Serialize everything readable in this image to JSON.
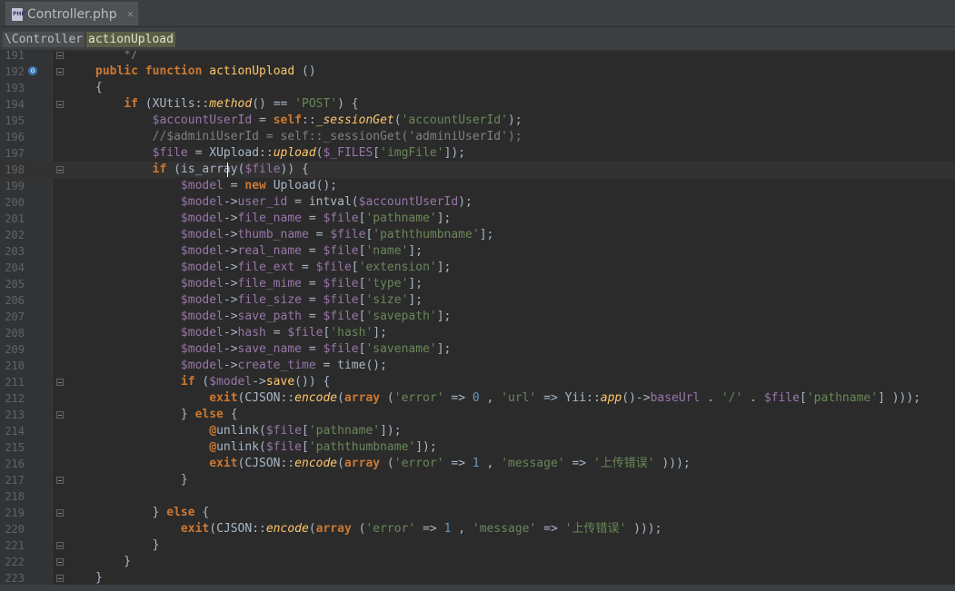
{
  "tab": {
    "file_name": "Controller.php",
    "icon": "php-file-icon",
    "close": "×"
  },
  "breadcrumb": {
    "class": "\\Controller",
    "method": "actionUpload"
  },
  "colors": {
    "background": "#2b2b2b",
    "keyword": "#cc7832",
    "function": "#ffc66d",
    "variable": "#9876aa",
    "string": "#6a8759",
    "number": "#6897bb",
    "comment": "#808080"
  },
  "lines": [
    {
      "n": "191",
      "t": "    */"
    },
    {
      "n": "192",
      "t": "public function actionUpload ()"
    },
    {
      "n": "193",
      "t": "{"
    },
    {
      "n": "194",
      "t": "    if (XUtils::method() == 'POST') {"
    },
    {
      "n": "195",
      "t": "        $accountUserId = self::_sessionGet('accountUserId');"
    },
    {
      "n": "196",
      "t": "        //$adminiUserId = self::_sessionGet('adminiUserId');"
    },
    {
      "n": "197",
      "t": "        $file = XUpload::upload($_FILES['imgFile']);"
    },
    {
      "n": "198",
      "t": "        if (is_array($file)) {"
    },
    {
      "n": "199",
      "t": "            $model = new Upload();"
    },
    {
      "n": "200",
      "t": "            $model->user_id = intval($accountUserId);"
    },
    {
      "n": "201",
      "t": "            $model->file_name = $file['pathname'];"
    },
    {
      "n": "202",
      "t": "            $model->thumb_name = $file['paththumbname'];"
    },
    {
      "n": "203",
      "t": "            $model->real_name = $file['name'];"
    },
    {
      "n": "204",
      "t": "            $model->file_ext = $file['extension'];"
    },
    {
      "n": "205",
      "t": "            $model->file_mime = $file['type'];"
    },
    {
      "n": "206",
      "t": "            $model->file_size = $file['size'];"
    },
    {
      "n": "207",
      "t": "            $model->save_path = $file['savepath'];"
    },
    {
      "n": "208",
      "t": "            $model->hash = $file['hash'];"
    },
    {
      "n": "209",
      "t": "            $model->save_name = $file['savename'];"
    },
    {
      "n": "210",
      "t": "            $model->create_time = time();"
    },
    {
      "n": "211",
      "t": "            if ($model->save()) {"
    },
    {
      "n": "212",
      "t": "                exit(CJSON::encode(array ('error' => 0 , 'url' => Yii::app()->baseUrl . '/' . $file['pathname'] )));"
    },
    {
      "n": "213",
      "t": "            } else {"
    },
    {
      "n": "214",
      "t": "                @unlink($file['pathname']);"
    },
    {
      "n": "215",
      "t": "                @unlink($file['paththumbname']);"
    },
    {
      "n": "216",
      "t": "                exit(CJSON::encode(array ('error' => 1 , 'message' => '上传错误' )));"
    },
    {
      "n": "217",
      "t": "            }"
    },
    {
      "n": "218",
      "t": ""
    },
    {
      "n": "219",
      "t": "        } else {"
    },
    {
      "n": "220",
      "t": "            exit(CJSON::encode(array ('error' => 1 , 'message' => '上传错误' )));"
    },
    {
      "n": "221",
      "t": "        }"
    },
    {
      "n": "222",
      "t": "    }"
    },
    {
      "n": "223",
      "t": "}"
    }
  ]
}
